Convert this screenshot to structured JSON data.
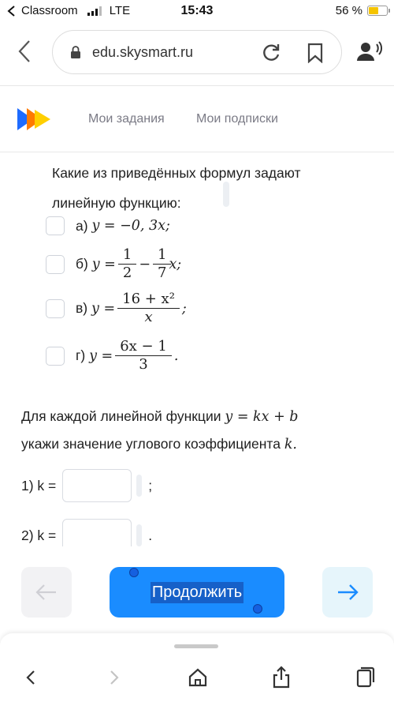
{
  "status_bar": {
    "carrier": "Classroom",
    "network": "LTE",
    "time": "15:43",
    "battery": "56 %",
    "battery_level": 0.56
  },
  "browser": {
    "url": "edu.skysmart.ru"
  },
  "site": {
    "nav": [
      "Мои задания",
      "Мои подписки"
    ],
    "logo_colors": [
      "#1e6bff",
      "#ff7a00",
      "#ffcf00"
    ]
  },
  "task1": {
    "prompt_line1": "Какие из приведённых формул задают",
    "prompt_line2": "линейную функцию:",
    "options": [
      {
        "label": "а)",
        "formula": "y = −0, 3x;"
      },
      {
        "label": "б)",
        "formula_prefix": "y =",
        "frac1_num": "1",
        "frac1_den": "2",
        "minus": "−",
        "frac2_num": "1",
        "frac2_den": "7",
        "formula_suffix": "x;"
      },
      {
        "label": "в)",
        "formula_prefix": "y =",
        "frac_num": "16 + x²",
        "frac_den": "x",
        "formula_suffix": ";"
      },
      {
        "label": "г)",
        "formula_prefix": "y =",
        "frac_num": "6x − 1",
        "frac_den": "3",
        "formula_suffix": "."
      }
    ]
  },
  "task2": {
    "line1_text": "Для каждой линейной функции ",
    "line1_formula": "y = kx + b",
    "line2_text": "укажи значение углового коэффициента ",
    "line2_formula": "k.",
    "answers": [
      {
        "label": "1) k =",
        "suffix": ";"
      },
      {
        "label": "2) k =",
        "suffix": "."
      }
    ]
  },
  "actions": {
    "continue_label": "Продолжить",
    "accent": "#1a8cff"
  }
}
